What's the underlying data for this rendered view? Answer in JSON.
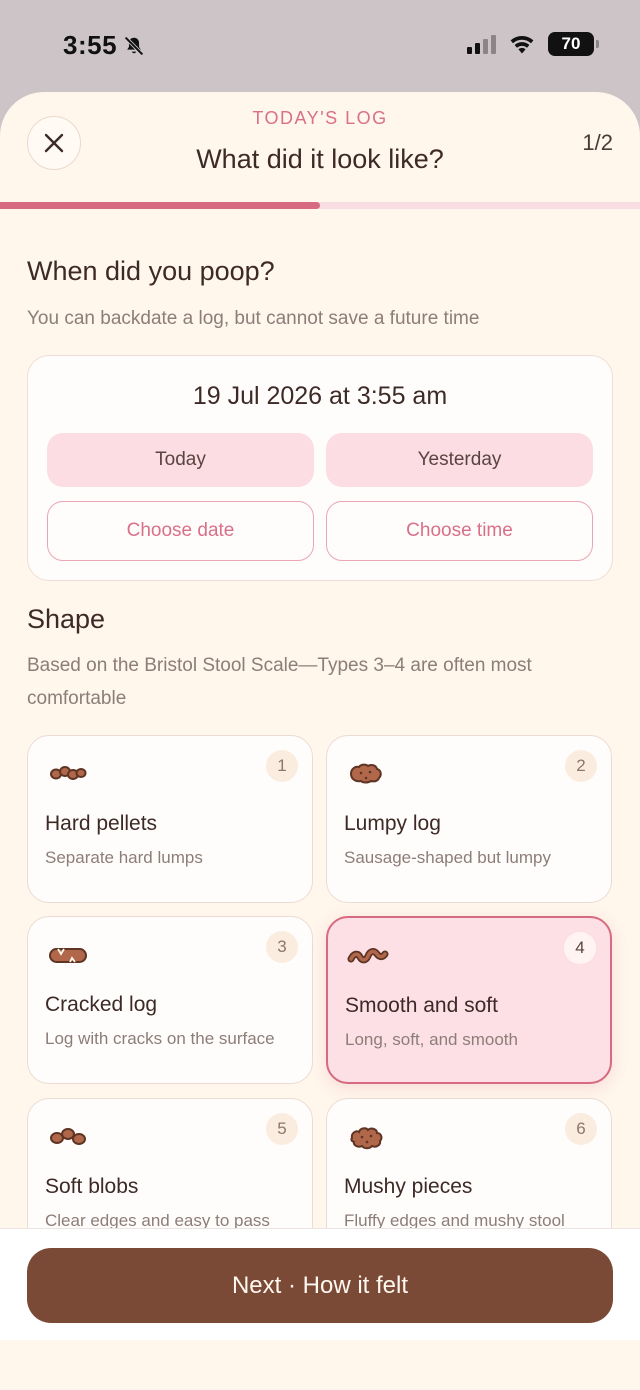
{
  "status_bar": {
    "time": "3:55",
    "battery": "70"
  },
  "header": {
    "eyebrow": "TODAY'S LOG",
    "title": "What did it look like?",
    "step": "1/2",
    "progress": 0.5
  },
  "when": {
    "title": "When did you poop?",
    "subtitle": "You can backdate a log, but cannot save a future time",
    "datetime": "19 Jul 2026 at 3:55 am",
    "today_label": "Today",
    "yesterday_label": "Yesterday",
    "choose_date_label": "Choose date",
    "choose_time_label": "Choose time"
  },
  "shape": {
    "title": "Shape",
    "subtitle": "Based on the Bristol Stool Scale—Types 3–4 are often most comfortable",
    "selected": "4",
    "types": [
      {
        "num": "1",
        "name": "Hard pellets",
        "desc": "Separate hard lumps",
        "icon": "pellets-icon"
      },
      {
        "num": "2",
        "name": "Lumpy log",
        "desc": "Sausage-shaped but lumpy",
        "icon": "lumpy-log-icon"
      },
      {
        "num": "3",
        "name": "Cracked log",
        "desc": "Log with cracks on the surface",
        "icon": "cracked-log-icon"
      },
      {
        "num": "4",
        "name": "Smooth and soft",
        "desc": "Long, soft, and smooth",
        "icon": "smooth-snake-icon"
      },
      {
        "num": "5",
        "name": "Soft blobs",
        "desc": "Clear edges and easy to pass",
        "icon": "soft-blobs-icon"
      },
      {
        "num": "6",
        "name": "Mushy pieces",
        "desc": "Fluffy edges and mushy stool",
        "icon": "mushy-pieces-icon"
      }
    ]
  },
  "footer": {
    "next_label": "Next · How it felt"
  },
  "colors": {
    "accent": "#d56a80",
    "brown": "#7b4a36",
    "sheet": "#fff6ec",
    "selected_bg": "#fde0e5"
  }
}
